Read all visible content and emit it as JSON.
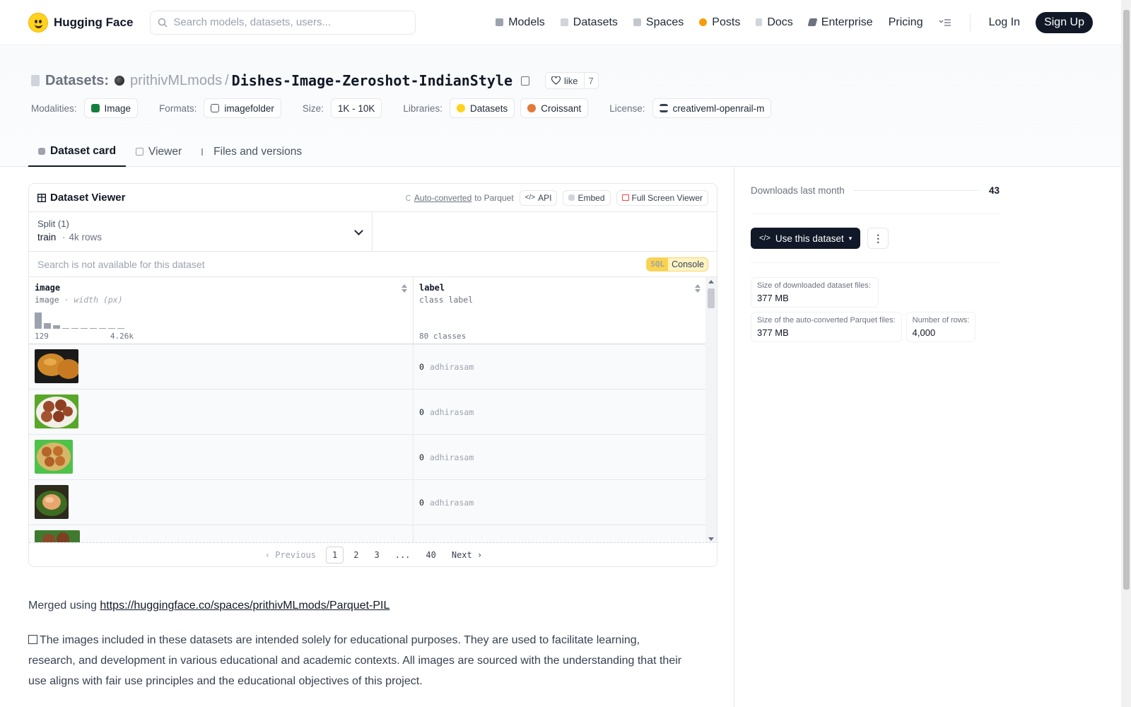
{
  "nav": {
    "brand": "Hugging Face",
    "search_placeholder": "Search models, datasets, users...",
    "items": [
      "Models",
      "Datasets",
      "Spaces",
      "Posts",
      "Docs",
      "Enterprise"
    ],
    "pricing": "Pricing",
    "login": "Log In",
    "signup": "Sign Up"
  },
  "header": {
    "section": "Datasets:",
    "owner": "prithivMLmods",
    "slash": "/",
    "name": "Dishes-Image-Zeroshot-IndianStyle",
    "like_label": "like",
    "like_count": "7",
    "tags": {
      "modalities_label": "Modalities:",
      "modality": "Image",
      "formats_label": "Formats:",
      "format": "imagefolder",
      "size_label": "Size:",
      "size": "1K - 10K",
      "libraries_label": "Libraries:",
      "lib1": "Datasets",
      "lib2": "Croissant",
      "license_label": "License:",
      "license": "creativeml-openrail-m"
    },
    "tabs": [
      "Dataset card",
      "Viewer",
      "Files and versions"
    ]
  },
  "viewer": {
    "title": "Dataset Viewer",
    "auto_link": "Auto-converted",
    "auto_rest": "to Parquet",
    "api": "API",
    "embed": "Embed",
    "fullscreen": "Full Screen Viewer",
    "split_label": "Split (1)",
    "split_name": "train",
    "split_dot": "·",
    "split_rows": "4k rows",
    "search_msg": "Search is not available for this dataset",
    "sql_tag": "SQL",
    "sql_label": "Console",
    "col1": {
      "name": "image",
      "type": "image",
      "sub": "· width (px)",
      "min": "129",
      "max": "4.26k"
    },
    "col2": {
      "name": "label",
      "type": "class label",
      "classes": "80 classes"
    },
    "histogram": [
      0.92,
      0.32,
      0.18,
      0.05,
      0.04,
      0.04,
      0.03,
      0.03,
      0.03,
      0.02
    ],
    "rows": [
      {
        "label_id": "0",
        "label_name": "adhirasam",
        "thumb": "fried-brown"
      },
      {
        "label_id": "0",
        "label_name": "adhirasam",
        "thumb": "plate-green"
      },
      {
        "label_id": "0",
        "label_name": "adhirasam",
        "thumb": "plate-green"
      },
      {
        "label_id": "0",
        "label_name": "adhirasam",
        "thumb": "bowl-leaf"
      }
    ],
    "pager": {
      "prev": "Previous",
      "pages": [
        "1",
        "2",
        "3",
        "...",
        "40"
      ],
      "next": "Next",
      "current": "1"
    }
  },
  "card": {
    "merged_prefix": "Merged using ",
    "merged_link": "https://huggingface.co/spaces/prithivMLmods/Parquet-PIL",
    "disclaimer": "The images included in these datasets are intended solely for educational purposes. They are used to facilitate learning, research, and development in various educational and academic contexts. All images are sourced with the understanding that their use aligns with fair use principles and the educational objectives of this project."
  },
  "sidebar": {
    "downloads_label": "Downloads last month",
    "downloads": "43",
    "use_btn": "Use this dataset",
    "stats": {
      "dl_size_k": "Size of downloaded dataset files:",
      "dl_size_v": "377 MB",
      "pq_size_k": "Size of the auto-converted Parquet files:",
      "pq_size_v": "377 MB",
      "rows_k": "Number of rows:",
      "rows_v": "4,000"
    }
  },
  "colors": {
    "brand_yellow": "#ffd21e",
    "dark": "#111827",
    "sql_yellow": "#fbd34d"
  }
}
